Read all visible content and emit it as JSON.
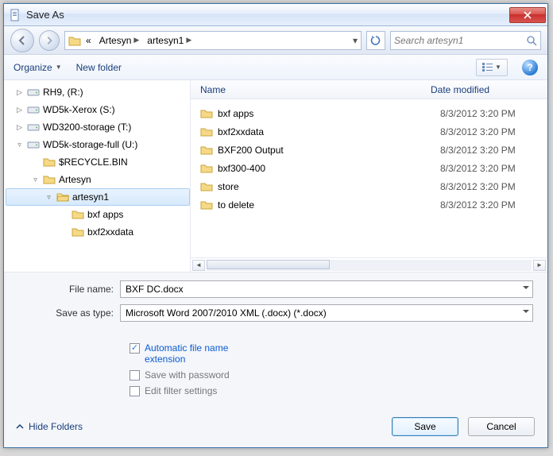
{
  "window": {
    "title": "Save As"
  },
  "nav": {
    "crumb_root_marker": "«",
    "crumb1": "Artesyn",
    "crumb2": "artesyn1",
    "search_placeholder": "Search artesyn1"
  },
  "toolbar": {
    "organize": "Organize",
    "newfolder": "New folder"
  },
  "tree": {
    "items": [
      {
        "label": "RH9, (R:)",
        "depth": 0,
        "icon": "drive",
        "exp": "▷"
      },
      {
        "label": "WD5k-Xerox (S:)",
        "depth": 0,
        "icon": "drive",
        "exp": "▷"
      },
      {
        "label": "WD3200-storage (T:)",
        "depth": 0,
        "icon": "drive",
        "exp": "▷"
      },
      {
        "label": "WD5k-storage-full (U:)",
        "depth": 0,
        "icon": "drive",
        "exp": "▿"
      },
      {
        "label": "$RECYCLE.BIN",
        "depth": 1,
        "icon": "folder",
        "exp": ""
      },
      {
        "label": "Artesyn",
        "depth": 1,
        "icon": "folder",
        "exp": "▿"
      },
      {
        "label": "artesyn1",
        "depth": 2,
        "icon": "folder-open",
        "exp": "▿",
        "selected": true
      },
      {
        "label": "bxf apps",
        "depth": 3,
        "icon": "folder",
        "exp": ""
      },
      {
        "label": "bxf2xxdata",
        "depth": 3,
        "icon": "folder",
        "exp": ""
      }
    ]
  },
  "list": {
    "headers": {
      "name": "Name",
      "date": "Date modified"
    },
    "rows": [
      {
        "name": "bxf apps",
        "date": "8/3/2012 3:20 PM"
      },
      {
        "name": "bxf2xxdata",
        "date": "8/3/2012 3:20 PM"
      },
      {
        "name": "BXF200 Output",
        "date": "8/3/2012 3:20 PM"
      },
      {
        "name": "bxf300-400",
        "date": "8/3/2012 3:20 PM"
      },
      {
        "name": "store",
        "date": "8/3/2012 3:20 PM"
      },
      {
        "name": "to delete",
        "date": "8/3/2012 3:20 PM"
      }
    ]
  },
  "form": {
    "filename_label": "File name:",
    "filename_value": "BXF DC.docx",
    "type_label": "Save as type:",
    "type_value": "Microsoft Word 2007/2010 XML (.docx) (*.docx)"
  },
  "options": {
    "auto_ext": "Automatic file name extension",
    "save_pwd": "Save with password",
    "edit_filter": "Edit filter settings"
  },
  "footer": {
    "hide": "Hide Folders",
    "save": "Save",
    "cancel": "Cancel"
  }
}
